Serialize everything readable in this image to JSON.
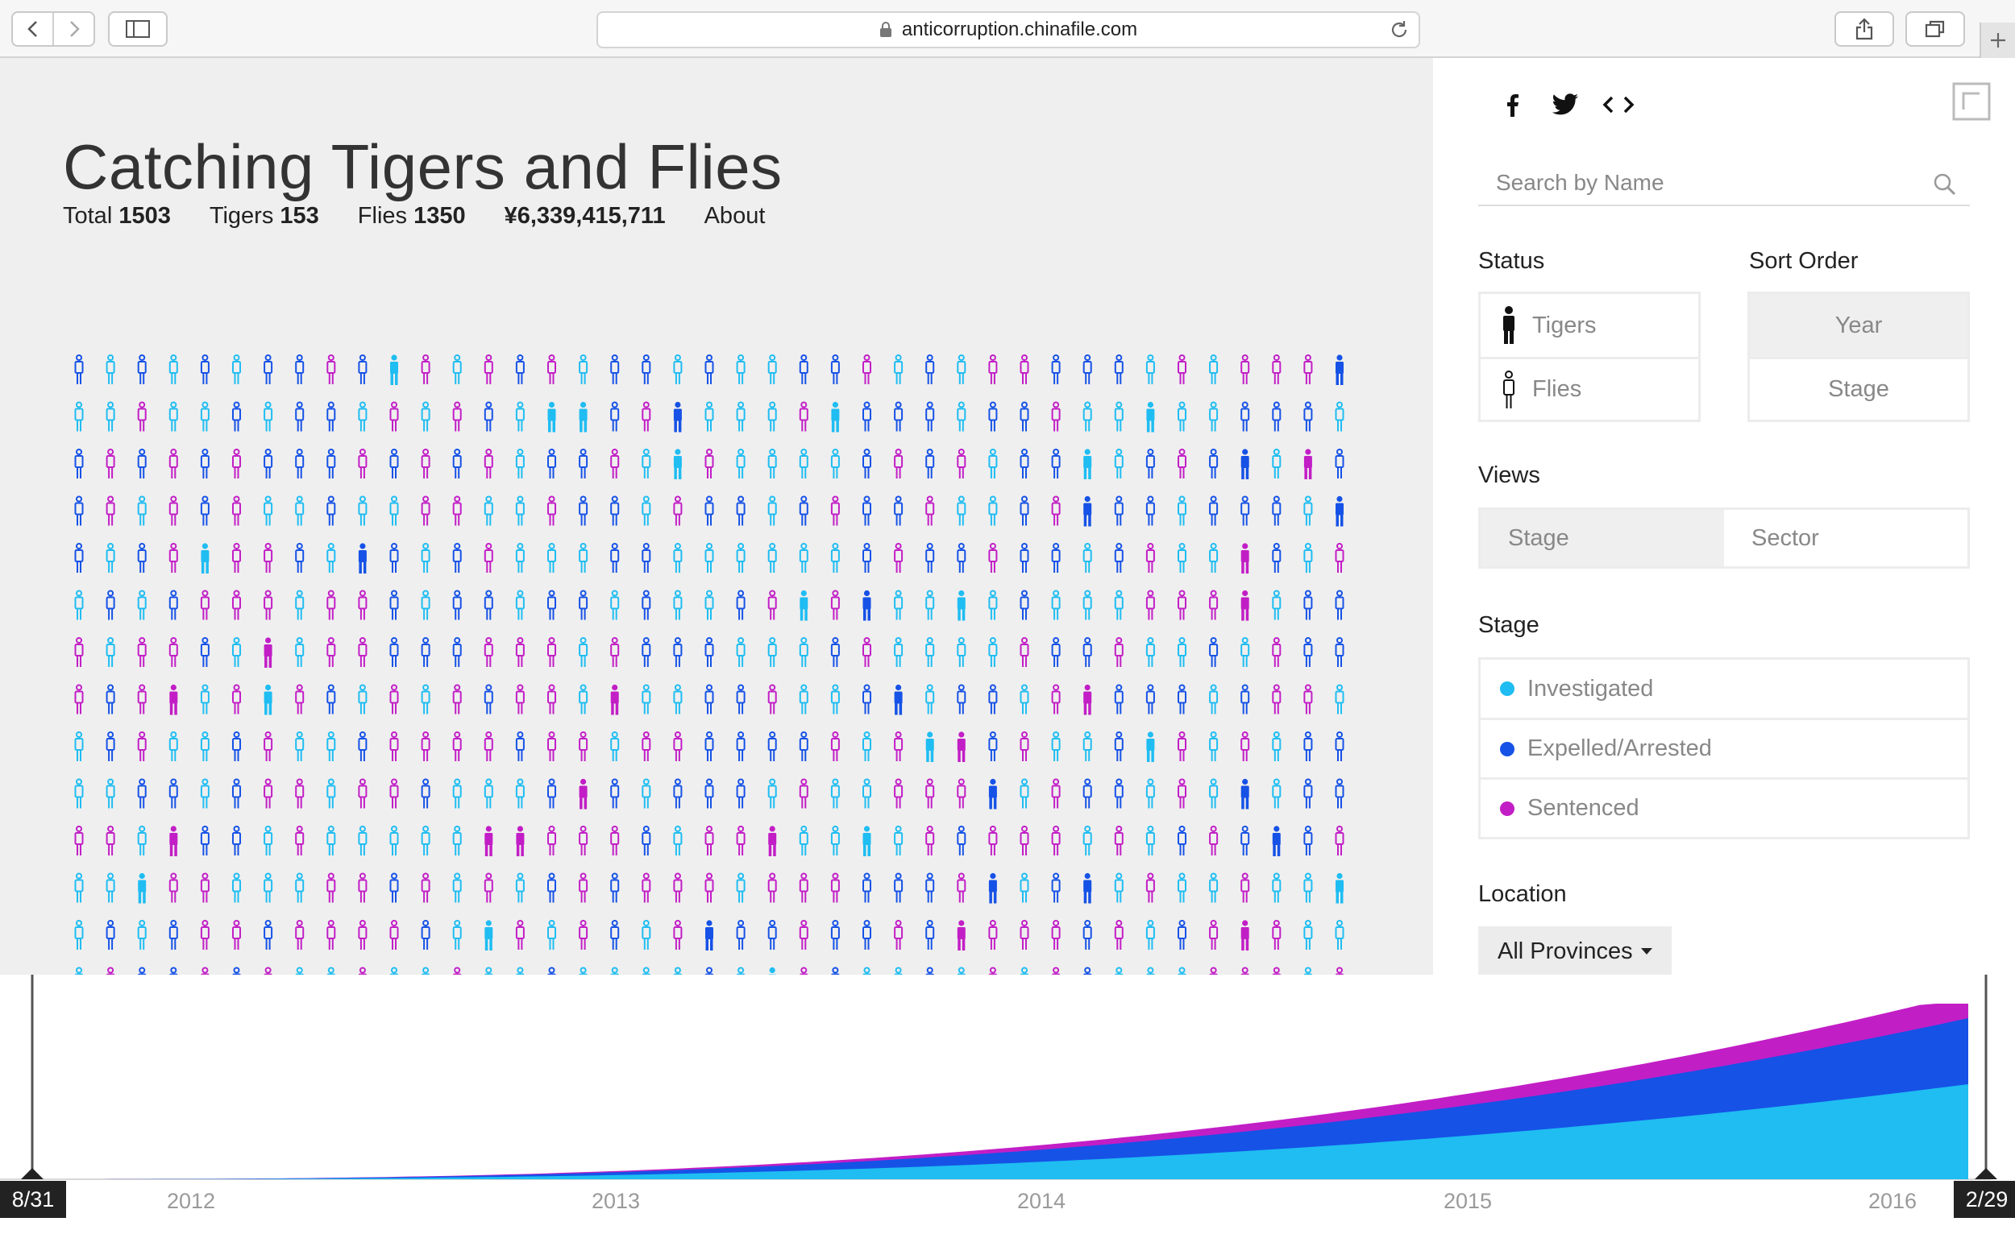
{
  "browser": {
    "url": "anticorruption.chinafile.com"
  },
  "header": {
    "title": "Catching Tigers and Flies",
    "total_label": "Total",
    "total_value": "1503",
    "tigers_label": "Tigers",
    "tigers_value": "153",
    "flies_label": "Flies",
    "flies_value": "1350",
    "amount": "¥6,339,415,711",
    "about": "About"
  },
  "colors": {
    "investigated": "#1fbdf2",
    "expelled": "#1652e6",
    "sentenced": "#c21ec6",
    "background": "#efefef"
  },
  "icons": [
    "facebook-icon",
    "twitter-icon",
    "embed-code-icon",
    "expand-icon",
    "search-icon",
    "tiger-figure-icon",
    "fly-figure-icon",
    "lock-icon",
    "reload-icon",
    "share-icon",
    "tabs-icon",
    "sidebar-icon"
  ],
  "sidebar": {
    "search_placeholder": "Search by Name",
    "status_label": "Status",
    "status_options": [
      "Tigers",
      "Flies"
    ],
    "sort_label": "Sort Order",
    "sort_options": [
      "Year",
      "Stage"
    ],
    "sort_selected": "Year",
    "views_label": "Views",
    "views_options": [
      "Stage",
      "Sector"
    ],
    "views_selected": "Stage",
    "stage_label": "Stage",
    "stage_options": [
      "Investigated",
      "Expelled/Arrested",
      "Sentenced"
    ],
    "location_label": "Location",
    "location_value": "All Provinces"
  },
  "timeline": {
    "start_label": "8/31",
    "end_label": "2/29",
    "years": [
      "2012",
      "2013",
      "2014",
      "2015",
      "2016"
    ]
  }
}
